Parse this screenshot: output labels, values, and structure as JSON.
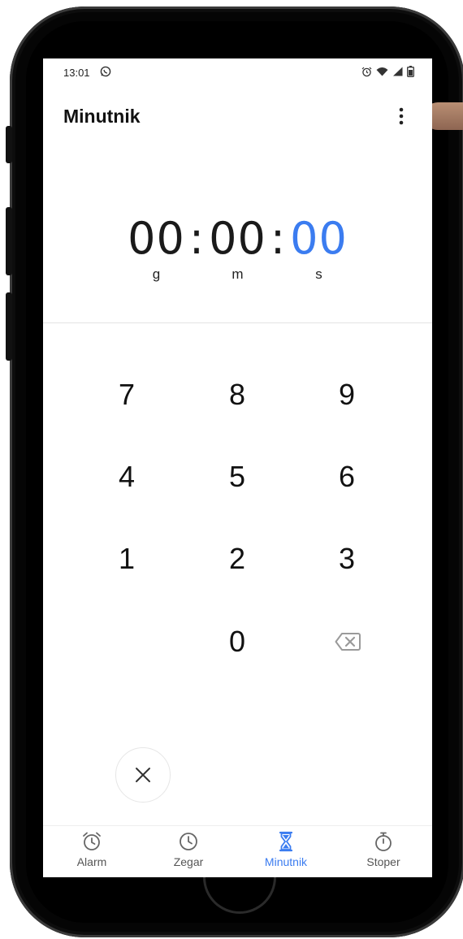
{
  "status_bar": {
    "time": "13:01",
    "icons": [
      "whatsapp-icon",
      "alarm-icon",
      "wifi-icon",
      "signal-icon",
      "battery-icon"
    ]
  },
  "header": {
    "title": "Minutnik",
    "menu_icon": "more-vertical-icon"
  },
  "timer": {
    "hours": "00",
    "minutes": "00",
    "seconds": "00",
    "separator": ":",
    "unit_hours": "g",
    "unit_minutes": "m",
    "unit_seconds": "s",
    "active_color": "#3b7cf0"
  },
  "keypad": {
    "k7": "7",
    "k8": "8",
    "k9": "9",
    "k4": "4",
    "k5": "5",
    "k6": "6",
    "k1": "1",
    "k2": "2",
    "k3": "3",
    "k0": "0",
    "backspace_icon": "backspace-icon"
  },
  "cancel_icon": "close-icon",
  "bottom_nav": {
    "alarm": "Alarm",
    "clock": "Zegar",
    "timer": "Minutnik",
    "stopwatch": "Stoper",
    "active": "Minutnik"
  }
}
